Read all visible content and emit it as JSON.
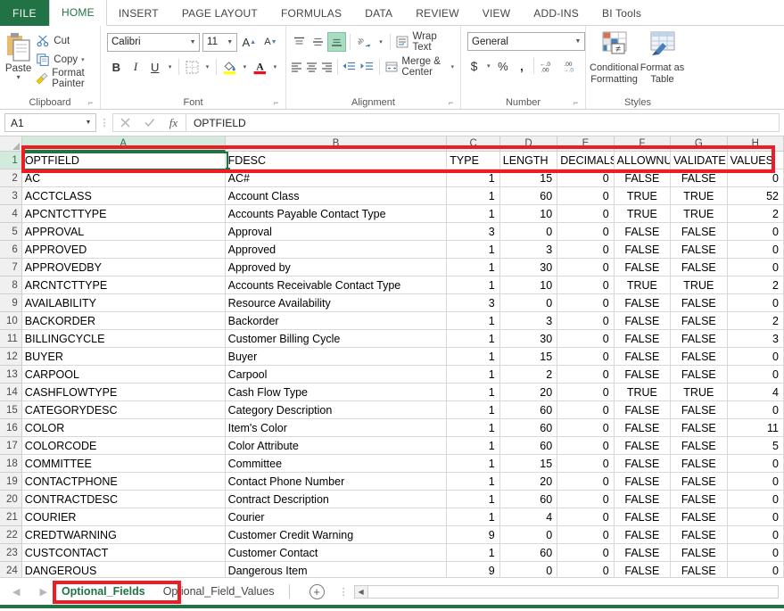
{
  "ribbon": {
    "file_tab": "FILE",
    "tabs": [
      "HOME",
      "INSERT",
      "PAGE LAYOUT",
      "FORMULAS",
      "DATA",
      "REVIEW",
      "VIEW",
      "ADD-INS",
      "BI Tools"
    ],
    "active_tab": "HOME",
    "groups": {
      "clipboard": {
        "label": "Clipboard",
        "paste": "Paste",
        "cut": "Cut",
        "copy": "Copy",
        "format_painter": "Format Painter"
      },
      "font": {
        "label": "Font",
        "font_name": "Calibri",
        "font_size": "11",
        "bold": "B",
        "italic": "I",
        "underline": "U"
      },
      "alignment": {
        "label": "Alignment",
        "wrap_text": "Wrap Text",
        "merge_center": "Merge & Center"
      },
      "number": {
        "label": "Number",
        "format": "General",
        "currency": "$",
        "percent": "%",
        "comma": ","
      },
      "styles": {
        "label": "Styles",
        "conditional_formatting": "Conditional Formatting",
        "format_as_table": "Format as Table"
      }
    }
  },
  "formula_bar": {
    "name_box": "A1",
    "formula_value": "OPTFIELD"
  },
  "sheet": {
    "column_headers": [
      "A",
      "B",
      "C",
      "D",
      "E",
      "F",
      "G",
      "H"
    ],
    "selected_column": "A",
    "selected_row": 1,
    "header_row": [
      "OPTFIELD",
      "FDESC",
      "TYPE",
      "LENGTH",
      "DECIMALS",
      "ALLOWNU",
      "VALIDATE",
      "VALUES"
    ],
    "rows": [
      {
        "n": 2,
        "cells": [
          "AC",
          "AC#",
          "1",
          "15",
          "0",
          "FALSE",
          "FALSE",
          "0"
        ]
      },
      {
        "n": 3,
        "cells": [
          "ACCTCLASS",
          "Account Class",
          "1",
          "60",
          "0",
          "TRUE",
          "TRUE",
          "52"
        ]
      },
      {
        "n": 4,
        "cells": [
          "APCNTCTTYPE",
          "Accounts Payable Contact Type",
          "1",
          "10",
          "0",
          "TRUE",
          "TRUE",
          "2"
        ]
      },
      {
        "n": 5,
        "cells": [
          "APPROVAL",
          "Approval",
          "3",
          "0",
          "0",
          "FALSE",
          "FALSE",
          "0"
        ]
      },
      {
        "n": 6,
        "cells": [
          "APPROVED",
          "Approved",
          "1",
          "3",
          "0",
          "FALSE",
          "FALSE",
          "0"
        ]
      },
      {
        "n": 7,
        "cells": [
          "APPROVEDBY",
          "Approved by",
          "1",
          "30",
          "0",
          "FALSE",
          "FALSE",
          "0"
        ]
      },
      {
        "n": 8,
        "cells": [
          "ARCNTCTTYPE",
          "Accounts Receivable Contact Type",
          "1",
          "10",
          "0",
          "TRUE",
          "TRUE",
          "2"
        ]
      },
      {
        "n": 9,
        "cells": [
          "AVAILABILITY",
          "Resource Availability",
          "3",
          "0",
          "0",
          "FALSE",
          "FALSE",
          "0"
        ]
      },
      {
        "n": 10,
        "cells": [
          "BACKORDER",
          "Backorder",
          "1",
          "3",
          "0",
          "FALSE",
          "FALSE",
          "2"
        ]
      },
      {
        "n": 11,
        "cells": [
          "BILLINGCYCLE",
          "Customer Billing Cycle",
          "1",
          "30",
          "0",
          "FALSE",
          "FALSE",
          "3"
        ]
      },
      {
        "n": 12,
        "cells": [
          "BUYER",
          "Buyer",
          "1",
          "15",
          "0",
          "FALSE",
          "FALSE",
          "0"
        ]
      },
      {
        "n": 13,
        "cells": [
          "CARPOOL",
          "Carpool",
          "1",
          "2",
          "0",
          "FALSE",
          "FALSE",
          "0"
        ]
      },
      {
        "n": 14,
        "cells": [
          "CASHFLOWTYPE",
          "Cash Flow Type",
          "1",
          "20",
          "0",
          "TRUE",
          "TRUE",
          "4"
        ]
      },
      {
        "n": 15,
        "cells": [
          "CATEGORYDESC",
          "Category Description",
          "1",
          "60",
          "0",
          "FALSE",
          "FALSE",
          "0"
        ]
      },
      {
        "n": 16,
        "cells": [
          "COLOR",
          "Item's Color",
          "1",
          "60",
          "0",
          "FALSE",
          "FALSE",
          "11"
        ]
      },
      {
        "n": 17,
        "cells": [
          "COLORCODE",
          "Color Attribute",
          "1",
          "60",
          "0",
          "FALSE",
          "FALSE",
          "5"
        ]
      },
      {
        "n": 18,
        "cells": [
          "COMMITTEE",
          "Committee",
          "1",
          "15",
          "0",
          "FALSE",
          "FALSE",
          "0"
        ]
      },
      {
        "n": 19,
        "cells": [
          "CONTACTPHONE",
          "Contact Phone Number",
          "1",
          "20",
          "0",
          "FALSE",
          "FALSE",
          "0"
        ]
      },
      {
        "n": 20,
        "cells": [
          "CONTRACTDESC",
          "Contract Description",
          "1",
          "60",
          "0",
          "FALSE",
          "FALSE",
          "0"
        ]
      },
      {
        "n": 21,
        "cells": [
          "COURIER",
          "Courier",
          "1",
          "4",
          "0",
          "FALSE",
          "FALSE",
          "0"
        ]
      },
      {
        "n": 22,
        "cells": [
          "CREDTWARNING",
          "Customer Credit Warning",
          "9",
          "0",
          "0",
          "FALSE",
          "FALSE",
          "0"
        ]
      },
      {
        "n": 23,
        "cells": [
          "CUSTCONTACT",
          "Customer Contact",
          "1",
          "60",
          "0",
          "FALSE",
          "FALSE",
          "0"
        ]
      },
      {
        "n": 24,
        "cells": [
          "DANGEROUS",
          "Dangerous Item",
          "9",
          "0",
          "0",
          "FALSE",
          "FALSE",
          "0"
        ]
      }
    ]
  },
  "sheet_tabs": {
    "tabs": [
      {
        "label": "Optional_Fields",
        "active": true
      },
      {
        "label": "Optional_Field_Values",
        "active": false
      }
    ],
    "add_sheet": "+"
  },
  "colors": {
    "excel_green": "#217346",
    "annotation_red": "#ee1c25",
    "selection_green": "#217346"
  }
}
